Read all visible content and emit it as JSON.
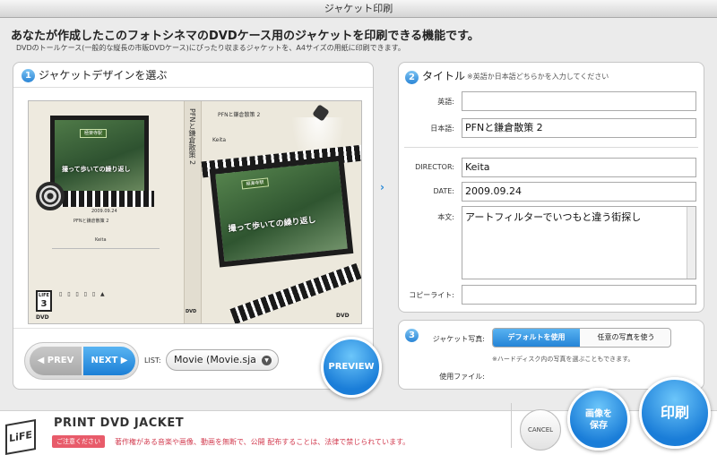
{
  "window": {
    "title": "ジャケット印刷"
  },
  "intro": {
    "headline": "あなたが作成したこのフォトシネマのDVDケース用のジャケットを印刷できる機能です。",
    "subline": "DVDのトールケース(一般的な縦長の市販DVDケース)にぴったり収まるジャケットを、A4サイズの用紙に印刷できます。"
  },
  "step1": {
    "number": "1",
    "title": "ジャケットデザインを選ぶ",
    "jacket": {
      "spine_title": "PFNと鎌倉散策 2",
      "back_date": "2009.09.24",
      "back_line": "PFNと鎌倉散策 2",
      "back_name": "Keita",
      "photo_title": "撮って歩いての繰り返し",
      "sign_text": "極楽寺駅",
      "front_title": "PFNと鎌倉散策 2",
      "front_name": "Keita",
      "logo_word": "LIFE",
      "logo_num": "3",
      "dvd_mark": "DVD"
    },
    "prev_label": "◀ PREV",
    "next_label": "NEXT ▶",
    "list_label": "LIST:",
    "list_value": "Movie (Movie.sja",
    "preview_label": "PREVIEW"
  },
  "step2": {
    "number": "2",
    "title": "タイトル",
    "hint": "※英語か日本語どちらかを入力してください",
    "fields": {
      "english_label": "英語:",
      "english_value": "",
      "japanese_label": "日本語:",
      "japanese_value": "PFNと鎌倉散策 2",
      "director_label": "DIRECTOR:",
      "director_value": "Keita",
      "date_label": "DATE:",
      "date_value": "2009.09.24",
      "body_label": "本文:",
      "body_value": "アートフィルターでいつもと違う街探し",
      "copyright_label": "コピーライト:",
      "copyright_value": ""
    }
  },
  "step3": {
    "number": "3",
    "photo_label": "ジャケット写真:",
    "option_default": "デフォルトを使用",
    "option_custom": "任意の写真を使う",
    "note": "※ハードディスク内の写真を選ぶこともできます。",
    "file_label": "使用ファイル:"
  },
  "footer": {
    "app_title": "PRINT DVD JACKET",
    "warning_badge": "ご注意ください",
    "warning_text": "著作権がある音楽や画像、動画を無断で、公開 配布することは、法律で禁じられています。",
    "logo_text": "LiFE"
  },
  "actions": {
    "cancel": "CANCEL",
    "save_line1": "画像を",
    "save_line2": "保存",
    "print": "印刷"
  },
  "colors": {
    "accent": "#1f7fd4",
    "warning": "#e85b6a"
  }
}
